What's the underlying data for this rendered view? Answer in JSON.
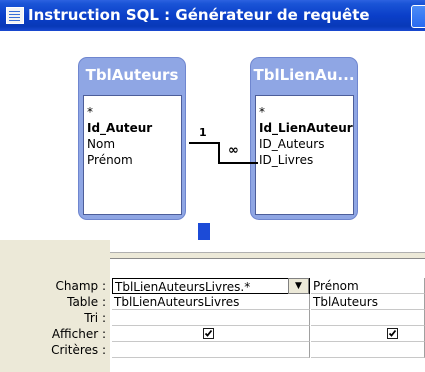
{
  "window": {
    "title": "Instruction SQL : Générateur de requête",
    "system_icon": "form-icon",
    "minimize_icon": "minimize-icon"
  },
  "design_view": {
    "tables": [
      {
        "name": "TblAuteurs",
        "fields": [
          {
            "label": "*",
            "key": false
          },
          {
            "label": "Id_Auteur",
            "key": true
          },
          {
            "label": "Nom",
            "key": false
          },
          {
            "label": "Prénom",
            "key": false
          }
        ]
      },
      {
        "name": "TblLienAu...",
        "fields": [
          {
            "label": "*",
            "key": false
          },
          {
            "label": "Id_LienAuteurLiv",
            "key": true
          },
          {
            "label": "ID_Auteurs",
            "key": false
          },
          {
            "label": "ID_Livres",
            "key": false
          }
        ]
      }
    ],
    "relationship": {
      "one_side": "1",
      "many_side": "∞"
    },
    "scroll_left_icon": "scroll-left-icon"
  },
  "query_grid": {
    "row_labels": {
      "champ": "Champ :",
      "table": "Table :",
      "tri": "Tri :",
      "afficher": "Afficher :",
      "criteres": "Critères :"
    },
    "columns": [
      {
        "champ": "TblLienAuteursLivres.*",
        "table": "TblLienAuteursLivres",
        "tri": "",
        "afficher": true,
        "criteres": ""
      },
      {
        "champ": "Prénom",
        "table": "TblAuteurs",
        "tri": "",
        "afficher": true,
        "criteres": ""
      }
    ],
    "dropdown_icon": "dropdown-arrow-icon",
    "dropdown_glyph": "▼"
  }
}
